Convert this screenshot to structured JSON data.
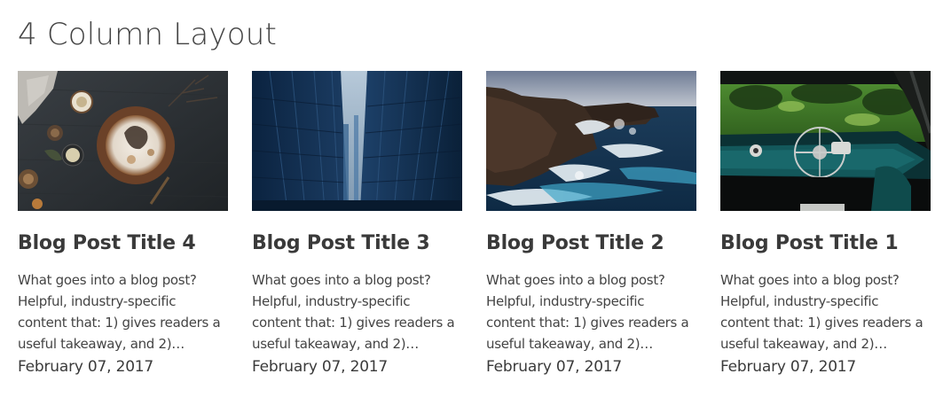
{
  "page": {
    "title": "4 Column Layout"
  },
  "posts": [
    {
      "title": "Blog Post Title 4",
      "excerpt": "What goes into a blog post? Helpful, industry-specific content that: 1) gives readers a useful takeaway, and 2)…",
      "date": "February 07, 2017",
      "image_icon": "food-flatlay-image"
    },
    {
      "title": "Blog Post Title 3",
      "excerpt": "What goes into a blog post? Helpful, industry-specific content that: 1) gives readers a useful takeaway, and 2)…",
      "date": "February 07, 2017",
      "image_icon": "city-buildings-image"
    },
    {
      "title": "Blog Post Title 2",
      "excerpt": "What goes into a blog post? Helpful, industry-specific content that: 1) gives readers a useful takeaway, and 2)…",
      "date": "February 07, 2017",
      "image_icon": "ocean-cliffs-image"
    },
    {
      "title": "Blog Post Title 1",
      "excerpt": "What goes into a blog post? Helpful, industry-specific content that: 1) gives readers a useful takeaway, and 2)…",
      "date": "February 07, 2017",
      "image_icon": "vintage-car-dashboard-image"
    }
  ]
}
